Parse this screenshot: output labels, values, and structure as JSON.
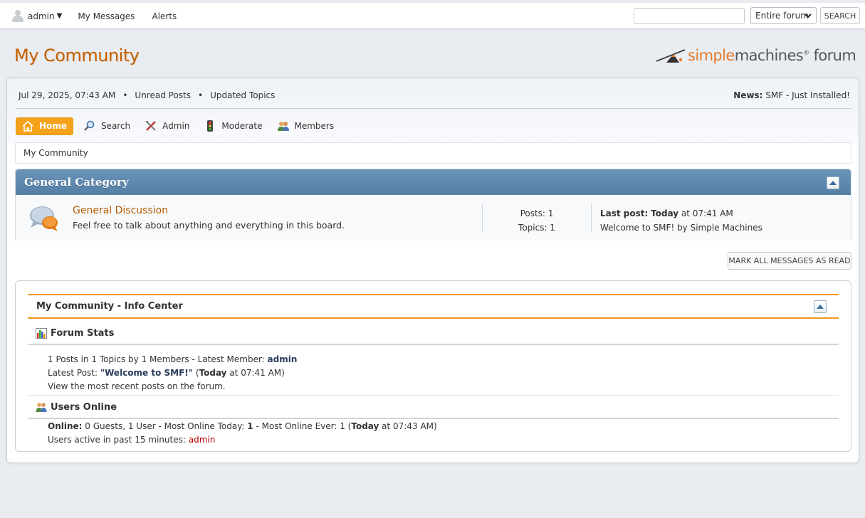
{
  "topbar": {
    "username": "admin",
    "user_caret": "▼",
    "messages": "My Messages",
    "alerts": "Alerts",
    "search_value": "",
    "search_scope": "Entire forum",
    "search_button": "SEARCH"
  },
  "header": {
    "forum_title": "My Community",
    "logo": {
      "simple": "simple",
      "machines": "machines",
      "reg": "®",
      "forum": " forum"
    }
  },
  "upper": {
    "datetime": "Jul 29, 2025, 07:43 AM",
    "sep": "•",
    "unread_posts": "Unread Posts",
    "updated_topics": "Updated Topics",
    "news_label": "News:",
    "news_text": "SMF - Just Installed!"
  },
  "menu": {
    "home": "Home",
    "search": "Search",
    "admin": "Admin",
    "moderate": "Moderate",
    "members": "Members"
  },
  "breadcrumb": "My Community",
  "category": {
    "title": "General Category",
    "board": {
      "name": "General Discussion",
      "description": "Feel free to talk about anything and everything in this board.",
      "posts": "Posts: 1",
      "topics": "Topics: 1",
      "last_post_label": "Last post:",
      "last_post_today": "Today",
      "last_post_time": " at 07:41 AM",
      "last_post_topic": "Welcome to SMF!",
      "last_post_by": " by ",
      "last_post_author": "Simple Machines"
    }
  },
  "mark_read_button": "MARK ALL MESSAGES AS READ",
  "info_center": {
    "title": "My Community - Info Center",
    "forum_stats": {
      "title": "Forum Stats",
      "line1_prefix": "1 Posts in 1 Topics by 1 Members - Latest Member: ",
      "latest_member": "admin",
      "line2_prefix": "Latest Post: ",
      "latest_post": "\"Welcome to SMF!\"",
      "line2_open": " (",
      "line2_today": "Today",
      "line2_suffix": " at 07:41 AM)",
      "line3": "View the most recent posts on the forum."
    },
    "users_online": {
      "title": "Users Online",
      "online_label": "Online:",
      "online_text": " 0 Guests, 1 User  - Most Online Today: ",
      "most_today": "1",
      "mid_text": " -  Most Online Ever: 1 (",
      "ever_today": "Today",
      "ever_suffix": " at 07:43 AM)",
      "active_prefix": "Users active in past 15 minutes: ",
      "active_user": "admin"
    }
  },
  "colors": {
    "accent_orange": "#f4a21a",
    "title_orange": "#c06002",
    "category_blue": "#5f89ae",
    "link_red": "#c0000a"
  }
}
